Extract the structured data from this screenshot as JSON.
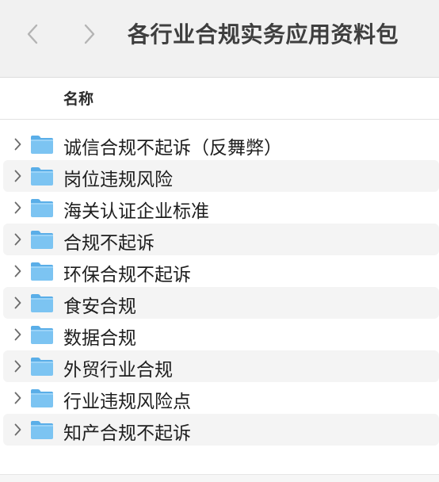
{
  "window": {
    "title": "各行业合规实务应用资料包"
  },
  "toolbar": {
    "back_icon": "chevron-left-icon",
    "forward_icon": "chevron-right-icon"
  },
  "list_header": {
    "name_column": "名称"
  },
  "colors": {
    "folder_blue": "#7cc4f2",
    "folder_tab": "#5aaee8",
    "alt_row": "#f4f4f4"
  },
  "folders": [
    {
      "name": "诚信合规不起诉（反舞弊）",
      "icon": "folder-icon"
    },
    {
      "name": "岗位违规风险",
      "icon": "folder-icon"
    },
    {
      "name": "海关认证企业标准",
      "icon": "folder-icon"
    },
    {
      "name": "合规不起诉",
      "icon": "folder-icon"
    },
    {
      "name": "环保合规不起诉",
      "icon": "folder-icon"
    },
    {
      "name": "食安合规",
      "icon": "folder-icon"
    },
    {
      "name": "数据合规",
      "icon": "folder-icon"
    },
    {
      "name": "外贸行业合规",
      "icon": "folder-icon"
    },
    {
      "name": "行业违规风险点",
      "icon": "folder-icon"
    },
    {
      "name": "知产合规不起诉",
      "icon": "folder-icon"
    }
  ]
}
